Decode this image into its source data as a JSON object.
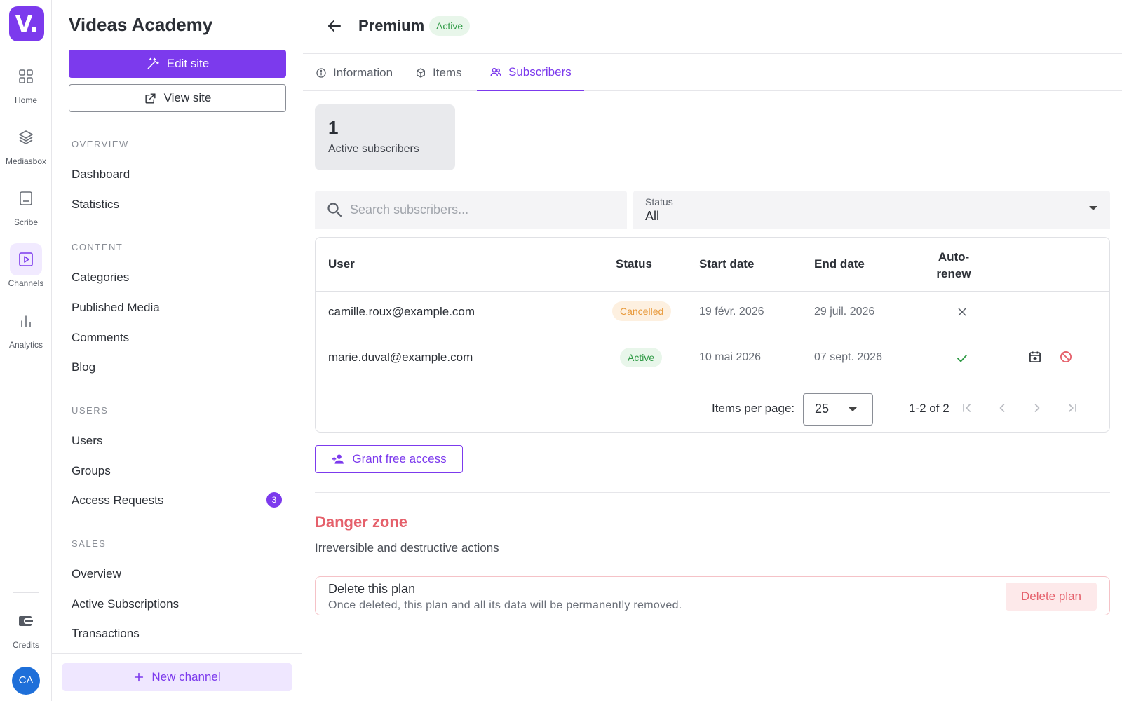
{
  "rail": {
    "logo": "V.",
    "items": [
      {
        "label": "Home",
        "icon": "grid-icon"
      },
      {
        "label": "Mediasbox",
        "icon": "layers-icon"
      },
      {
        "label": "Scribe",
        "icon": "scribe-icon"
      },
      {
        "label": "Channels",
        "icon": "play-square-icon"
      },
      {
        "label": "Analytics",
        "icon": "bar-chart-icon"
      }
    ],
    "credits_label": "Credits",
    "avatar_initials": "CA"
  },
  "sidebar": {
    "site_title": "Videas Academy",
    "edit_site_label": "Edit site",
    "view_site_label": "View site",
    "sections": [
      {
        "label": "OVERVIEW",
        "items": [
          {
            "label": "Dashboard"
          },
          {
            "label": "Statistics"
          }
        ]
      },
      {
        "label": "CONTENT",
        "items": [
          {
            "label": "Categories"
          },
          {
            "label": "Published Media"
          },
          {
            "label": "Comments"
          },
          {
            "label": "Blog"
          }
        ]
      },
      {
        "label": "USERS",
        "items": [
          {
            "label": "Users"
          },
          {
            "label": "Groups"
          },
          {
            "label": "Access Requests",
            "badge": "3"
          }
        ]
      },
      {
        "label": "SALES",
        "items": [
          {
            "label": "Overview"
          },
          {
            "label": "Active Subscriptions"
          },
          {
            "label": "Transactions"
          }
        ]
      }
    ],
    "new_channel_label": "New channel"
  },
  "header": {
    "title": "Premium",
    "status": "Active"
  },
  "tabs": [
    {
      "label": "Information",
      "icon": "info-icon"
    },
    {
      "label": "Items",
      "icon": "cube-icon"
    },
    {
      "label": "Subscribers",
      "icon": "people-icon",
      "active": true
    }
  ],
  "stats": {
    "active_subscribers_count": "1",
    "active_subscribers_label": "Active subscribers"
  },
  "filters": {
    "search_placeholder": "Search subscribers...",
    "status_label": "Status",
    "status_value": "All"
  },
  "table": {
    "columns": {
      "user": "User",
      "status": "Status",
      "start_date": "Start date",
      "end_date": "End date",
      "auto_renew_line1": "Auto-",
      "auto_renew_line2": "renew"
    },
    "rows": [
      {
        "user": "camille.roux@example.com",
        "status": "Cancelled",
        "start_date": "19 févr. 2026",
        "end_date": "29 juil. 2026",
        "auto_renew": false
      },
      {
        "user": "marie.duval@example.com",
        "status": "Active",
        "start_date": "10 mai 2026",
        "end_date": "07 sept. 2026",
        "auto_renew": true
      }
    ],
    "pagination": {
      "items_per_page_label": "Items per page:",
      "items_per_page": "25",
      "range": "1-2 of 2"
    }
  },
  "grant_free_access_label": "Grant free access",
  "danger_zone": {
    "title": "Danger zone",
    "subtitle": "Irreversible and destructive actions",
    "delete_title": "Delete this plan",
    "delete_description": "Once deleted, this plan and all its data will be permanently removed.",
    "delete_button": "Delete plan"
  },
  "colors": {
    "accent": "#7c3aed",
    "active_green": "#2f9a45",
    "cancelled_orange": "#e89a3c",
    "danger_red": "#e5606b"
  }
}
